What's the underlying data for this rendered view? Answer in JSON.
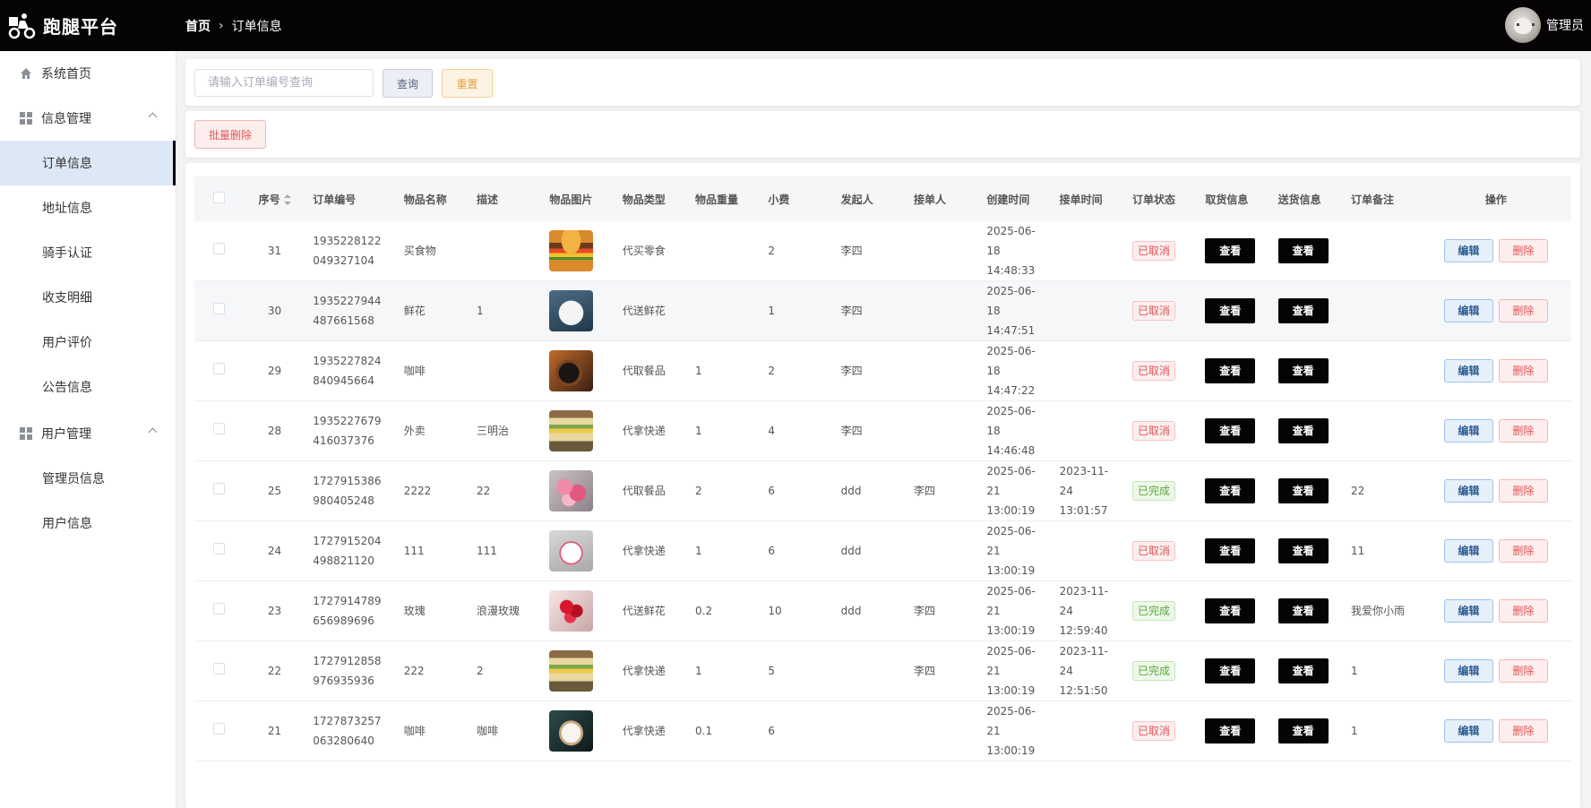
{
  "app": {
    "title": "跑腿平台"
  },
  "breadcrumb": {
    "home": "首页",
    "current": "订单信息"
  },
  "user": {
    "name": "管理员"
  },
  "sidebar": {
    "home": "系统首页",
    "group1": {
      "label": "信息管理",
      "items": [
        "订单信息",
        "地址信息",
        "骑手认证",
        "收支明细",
        "用户评价",
        "公告信息"
      ]
    },
    "group2": {
      "label": "用户管理",
      "items": [
        "管理员信息",
        "用户信息"
      ]
    }
  },
  "search": {
    "placeholder": "请输入订单编号查询",
    "query_label": "查询",
    "reset_label": "重置"
  },
  "actions": {
    "batch_delete_label": "批量删除"
  },
  "table": {
    "headers": [
      "序号",
      "订单编号",
      "物品名称",
      "描述",
      "物品图片",
      "物品类型",
      "物品重量",
      "小费",
      "发起人",
      "接单人",
      "创建时间",
      "接单时间",
      "订单状态",
      "取货信息",
      "送货信息",
      "订单备注",
      "操作"
    ],
    "view_label": "查看",
    "edit_label": "编辑",
    "delete_label": "删除",
    "rows": [
      {
        "id": "31",
        "order_no_1": "1935228122",
        "order_no_2": "049327104",
        "name": "买食物",
        "desc": "",
        "image": "burger",
        "type": "代买零食",
        "weight": "",
        "tip": "2",
        "creator": "李四",
        "taker": "",
        "created_1": "2025-06-18",
        "created_2": "14:48:33",
        "taken_1": "",
        "taken_2": "",
        "status": "已取消",
        "status_kind": "cancel",
        "note": ""
      },
      {
        "id": "30",
        "order_no_1": "1935227944",
        "order_no_2": "487661568",
        "name": "鲜花",
        "desc": "1",
        "image": "bear",
        "type": "代送鲜花",
        "weight": "",
        "tip": "1",
        "creator": "李四",
        "taker": "",
        "created_1": "2025-06-18",
        "created_2": "14:47:51",
        "taken_1": "",
        "taken_2": "",
        "status": "已取消",
        "status_kind": "cancel",
        "note": ""
      },
      {
        "id": "29",
        "order_no_1": "1935227824",
        "order_no_2": "840945664",
        "name": "咖啡",
        "desc": "",
        "image": "coffee",
        "type": "代取餐品",
        "weight": "1",
        "tip": "2",
        "creator": "李四",
        "taker": "",
        "created_1": "2025-06-18",
        "created_2": "14:47:22",
        "taken_1": "",
        "taken_2": "",
        "status": "已取消",
        "status_kind": "cancel",
        "note": ""
      },
      {
        "id": "28",
        "order_no_1": "1935227679",
        "order_no_2": "416037376",
        "name": "外卖",
        "desc": "三明治",
        "image": "sandwich",
        "type": "代拿快递",
        "weight": "1",
        "tip": "4",
        "creator": "李四",
        "taker": "",
        "created_1": "2025-06-18",
        "created_2": "14:46:48",
        "taken_1": "",
        "taken_2": "",
        "status": "已取消",
        "status_kind": "cancel",
        "note": ""
      },
      {
        "id": "25",
        "order_no_1": "1727915386",
        "order_no_2": "980405248",
        "name": "2222",
        "desc": "22",
        "image": "flowers",
        "type": "代取餐品",
        "weight": "2",
        "tip": "6",
        "creator": "ddd",
        "taker": "李四",
        "created_1": "2025-06-21",
        "created_2": "13:00:19",
        "taken_1": "2023-11-24",
        "taken_2": "13:01:57",
        "status": "已完成",
        "status_kind": "done",
        "note": "22"
      },
      {
        "id": "24",
        "order_no_1": "1727915204",
        "order_no_2": "498821120",
        "name": "111",
        "desc": "111",
        "image": "cake",
        "type": "代拿快递",
        "weight": "1",
        "tip": "6",
        "creator": "ddd",
        "taker": "",
        "created_1": "2025-06-21",
        "created_2": "13:00:19",
        "taken_1": "",
        "taken_2": "",
        "status": "已取消",
        "status_kind": "cancel",
        "note": "11"
      },
      {
        "id": "23",
        "order_no_1": "1727914789",
        "order_no_2": "656989696",
        "name": "玫瑰",
        "desc": "浪漫玫瑰",
        "image": "roses",
        "type": "代送鲜花",
        "weight": "0.2",
        "tip": "10",
        "creator": "ddd",
        "taker": "李四",
        "created_1": "2025-06-21",
        "created_2": "13:00:19",
        "taken_1": "2023-11-24",
        "taken_2": "12:59:40",
        "status": "已完成",
        "status_kind": "done",
        "note": "我爱你小雨"
      },
      {
        "id": "22",
        "order_no_1": "1727912858",
        "order_no_2": "976935936",
        "name": "222",
        "desc": "2",
        "image": "sandwich",
        "type": "代拿快递",
        "weight": "1",
        "tip": "5",
        "creator": "",
        "taker": "李四",
        "created_1": "2025-06-21",
        "created_2": "13:00:19",
        "taken_1": "2023-11-24",
        "taken_2": "12:51:50",
        "status": "已完成",
        "status_kind": "done",
        "note": "1"
      },
      {
        "id": "21",
        "order_no_1": "1727873257",
        "order_no_2": "063280640",
        "name": "咖啡",
        "desc": "咖啡",
        "image": "latte",
        "type": "代拿快递",
        "weight": "0.1",
        "tip": "6",
        "creator": "",
        "taker": "",
        "created_1": "2025-06-21",
        "created_2": "13:00:19",
        "taken_1": "",
        "taken_2": "",
        "status": "已取消",
        "status_kind": "cancel",
        "note": "1"
      }
    ]
  }
}
